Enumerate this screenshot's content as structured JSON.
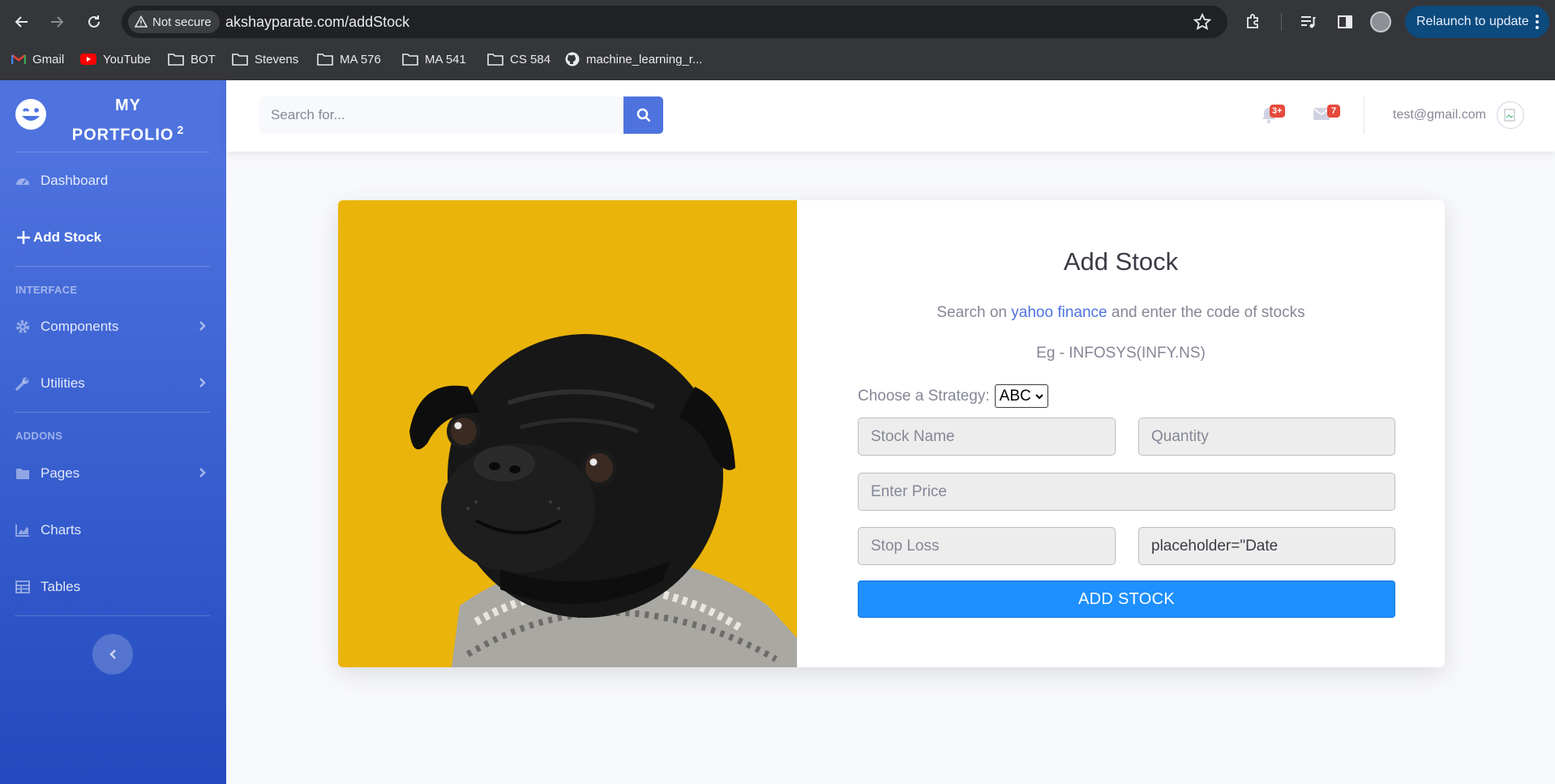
{
  "browser": {
    "security_label": "Not secure",
    "url": "akshayparate.com/addStock",
    "relaunch_label": "Relaunch to update",
    "bookmarks": [
      "Gmail",
      "YouTube",
      "BOT",
      "Stevens",
      "MA 576",
      "MA 541",
      "CS 584",
      "machine_learning_r..."
    ]
  },
  "sidebar": {
    "brand_line1": "MY",
    "brand_line2": "PORTFOLIO",
    "brand_sup": "2",
    "items": {
      "dashboard": "Dashboard",
      "add_stock": "Add Stock",
      "components": "Components",
      "utilities": "Utilities",
      "pages": "Pages",
      "charts": "Charts",
      "tables": "Tables"
    },
    "headings": {
      "interface": "INTERFACE",
      "addons": "ADDONS"
    }
  },
  "topbar": {
    "search_placeholder": "Search for...",
    "alerts_count": "3+",
    "messages_count": "7",
    "user_email": "test@gmail.com"
  },
  "form": {
    "title": "Add Stock",
    "hint_prefix": "Search on",
    "hint_link": "yahoo finance",
    "hint_suffix": "and enter the code of stocks",
    "example": "Eg - INFOSYS(INFY.NS)",
    "strategy_label": "Choose a Strategy:",
    "strategy_value": "ABC",
    "stock_name_placeholder": "Stock Name",
    "quantity_placeholder": "Quantity",
    "price_placeholder": "Enter Price",
    "stop_loss_placeholder": "Stop Loss",
    "date_value": "placeholder=\"Date",
    "submit_label": "ADD STOCK"
  },
  "colors": {
    "sidebar_top": "#4e73df",
    "sidebar_bottom": "#224abe",
    "submit": "#1e90ff",
    "photo_background": "#eab40a",
    "badge": "#e74a3b"
  }
}
